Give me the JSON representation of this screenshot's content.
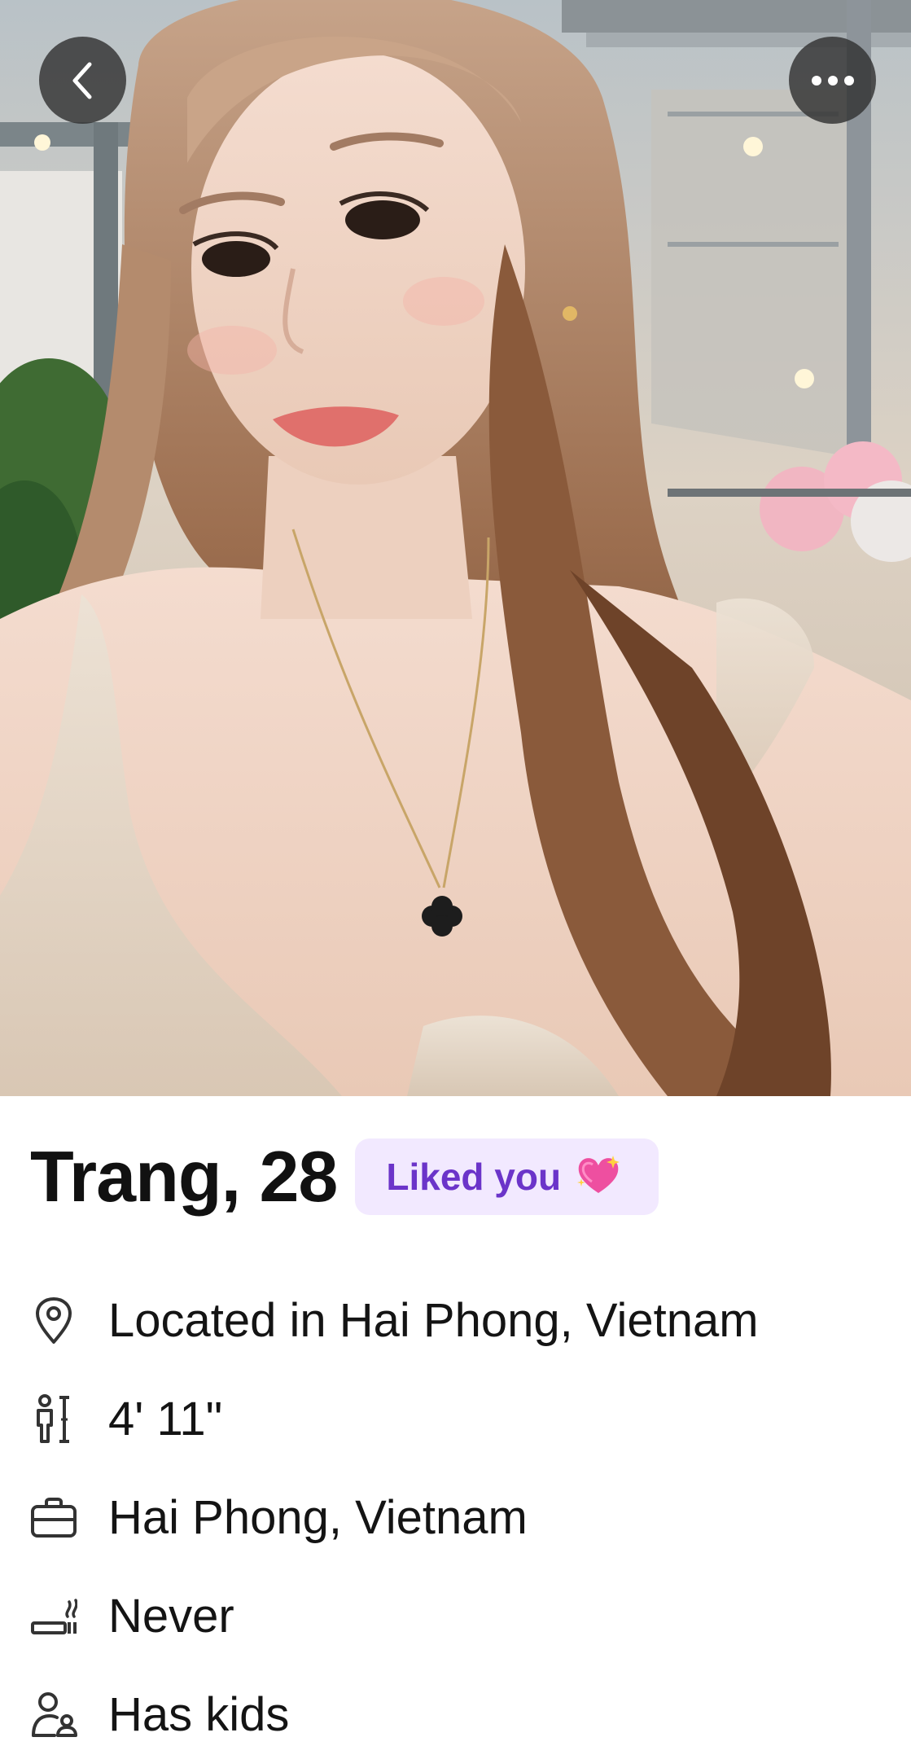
{
  "profile": {
    "name_age": "Trang, 28",
    "liked_badge": "Liked you"
  },
  "details": [
    {
      "icon": "location-pin-icon",
      "text": "Located in Hai Phong, Vietnam"
    },
    {
      "icon": "height-icon",
      "text": "4' 11\""
    },
    {
      "icon": "briefcase-icon",
      "text": "Hai Phong, Vietnam"
    },
    {
      "icon": "smoking-icon",
      "text": "Never"
    },
    {
      "icon": "family-icon",
      "text": "Has kids"
    }
  ],
  "colors": {
    "badge_bg": "#f2e9ff",
    "badge_text": "#6b34c9",
    "overlay_button": "#323232"
  }
}
